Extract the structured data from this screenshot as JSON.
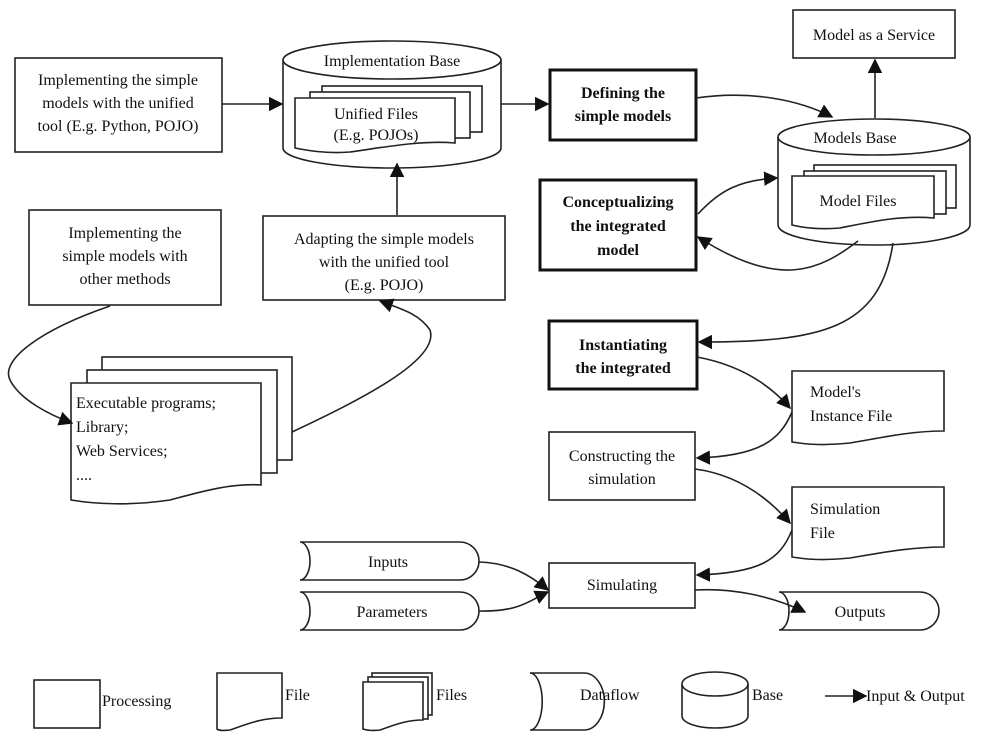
{
  "nodes": {
    "impl_unified": [
      "Implementing the simple",
      "models with the unified",
      "tool (E.g. Python, POJO)"
    ],
    "impl_base_title": "Implementation Base",
    "unified_files": [
      "Unified Files",
      "(E.g. POJOs)"
    ],
    "defining": [
      "Defining the",
      "simple models"
    ],
    "maas": "Model as a Service",
    "models_base_title": "Models Base",
    "model_files": "Model Files",
    "conceptualizing": [
      "Conceptualizing",
      "the integrated",
      "model"
    ],
    "impl_other": [
      "Implementing the",
      "simple models with",
      "other methods"
    ],
    "adapting": [
      "Adapting the simple models",
      "with the unified tool",
      "(E.g. POJO)"
    ],
    "exec_files": [
      "Executable programs;",
      "Library;",
      "Web Services;",
      "...."
    ],
    "instantiating": [
      "Instantiating",
      "the integrated"
    ],
    "instance_file": [
      "Model's",
      "Instance File"
    ],
    "constructing": [
      "Constructing the",
      "simulation"
    ],
    "simulation_file": [
      "Simulation",
      "File"
    ],
    "inputs": "Inputs",
    "parameters": "Parameters",
    "simulating": "Simulating",
    "outputs": "Outputs"
  },
  "legend": {
    "processing": "Processing",
    "file": "File",
    "files": "Files",
    "dataflow": "Dataflow",
    "base": "Base",
    "io": "Input & Output"
  }
}
